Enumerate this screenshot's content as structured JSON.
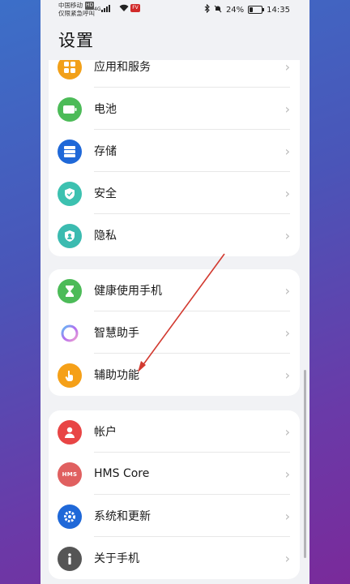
{
  "status": {
    "carrier_line1": "中国移动",
    "carrier_hd": "HD",
    "carrier_line2": "仅限紧急呼叫",
    "network": "4G",
    "app_badge": "FV",
    "battery": "24%",
    "battery_level": 0.24,
    "time": "14:35"
  },
  "page": {
    "title": "设置"
  },
  "cards": [
    {
      "items": [
        {
          "id": "apps",
          "label": "应用和服务",
          "icon": "apps-grid-icon",
          "color": "#f2a019"
        },
        {
          "id": "battery",
          "label": "电池",
          "icon": "battery-icon",
          "color": "#4cbb58"
        },
        {
          "id": "storage",
          "label": "存储",
          "icon": "storage-icon",
          "color": "#1f68d8"
        },
        {
          "id": "security",
          "label": "安全",
          "icon": "shield-icon",
          "color": "#3cc1b0"
        },
        {
          "id": "privacy",
          "label": "隐私",
          "icon": "privacy-icon",
          "color": "#3bbbb0"
        }
      ]
    },
    {
      "items": [
        {
          "id": "health",
          "label": "健康使用手机",
          "icon": "hourglass-icon",
          "color": "#4cbb58"
        },
        {
          "id": "assistant",
          "label": "智慧助手",
          "icon": "assistant-ring-icon",
          "color": "#b07ae8"
        },
        {
          "id": "accessibility",
          "label": "辅助功能",
          "icon": "hand-icon",
          "color": "#f5a018"
        }
      ]
    },
    {
      "items": [
        {
          "id": "account",
          "label": "帐户",
          "icon": "user-icon",
          "color": "#e84545"
        },
        {
          "id": "hms",
          "label": "HMS Core",
          "icon": "hms-icon",
          "color": "#e06060",
          "badge": "HMS"
        },
        {
          "id": "update",
          "label": "系统和更新",
          "icon": "gear-icon",
          "color": "#1f68d8"
        },
        {
          "id": "about",
          "label": "关于手机",
          "icon": "info-icon",
          "color": "#555555"
        }
      ]
    }
  ],
  "chevron": "›"
}
